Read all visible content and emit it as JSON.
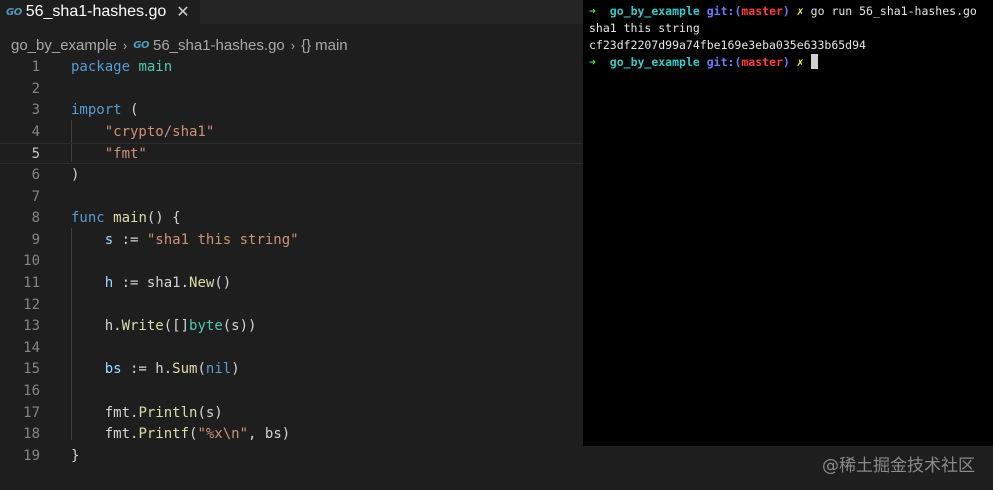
{
  "tab": {
    "icon": "go-file-icon",
    "icon_text": "GO",
    "title": "56_sha1-hashes.go",
    "close": "✕"
  },
  "breadcrumb": {
    "folder": "go_by_example",
    "sep": "›",
    "file_icon_text": "GO",
    "file": "56_sha1-hashes.go",
    "symbol_icon": "{}",
    "symbol": "main"
  },
  "editor": {
    "current_line": 5,
    "lines": [
      {
        "n": "1",
        "tokens": [
          {
            "t": "package",
            "c": "kw"
          },
          {
            "t": " main",
            "c": "ty"
          }
        ]
      },
      {
        "n": "2",
        "tokens": []
      },
      {
        "n": "3",
        "tokens": [
          {
            "t": "import",
            "c": "kw"
          },
          {
            "t": " (",
            "c": "pl"
          }
        ]
      },
      {
        "n": "4",
        "tokens": [
          {
            "t": "    \"crypto/sha1\"",
            "c": "str"
          }
        ]
      },
      {
        "n": "5",
        "tokens": [
          {
            "t": "    \"fmt\"",
            "c": "str"
          }
        ]
      },
      {
        "n": "6",
        "tokens": [
          {
            "t": ")",
            "c": "pl"
          }
        ]
      },
      {
        "n": "7",
        "tokens": []
      },
      {
        "n": "8",
        "tokens": [
          {
            "t": "func",
            "c": "kw"
          },
          {
            "t": " ",
            "c": "pl"
          },
          {
            "t": "main",
            "c": "fn"
          },
          {
            "t": "() {",
            "c": "pl"
          }
        ]
      },
      {
        "n": "9",
        "tokens": [
          {
            "t": "    s",
            "c": "var"
          },
          {
            "t": " := ",
            "c": "pl"
          },
          {
            "t": "\"sha1 this string\"",
            "c": "str"
          }
        ]
      },
      {
        "n": "10",
        "tokens": []
      },
      {
        "n": "11",
        "tokens": [
          {
            "t": "    h",
            "c": "var"
          },
          {
            "t": " := sha1.",
            "c": "pl"
          },
          {
            "t": "New",
            "c": "fn"
          },
          {
            "t": "()",
            "c": "pl"
          }
        ]
      },
      {
        "n": "12",
        "tokens": []
      },
      {
        "n": "13",
        "tokens": [
          {
            "t": "    h.",
            "c": "pl"
          },
          {
            "t": "Write",
            "c": "fn"
          },
          {
            "t": "([]",
            "c": "pl"
          },
          {
            "t": "byte",
            "c": "ty"
          },
          {
            "t": "(s))",
            "c": "pl"
          }
        ]
      },
      {
        "n": "14",
        "tokens": []
      },
      {
        "n": "15",
        "tokens": [
          {
            "t": "    bs",
            "c": "var"
          },
          {
            "t": " := h.",
            "c": "pl"
          },
          {
            "t": "Sum",
            "c": "fn"
          },
          {
            "t": "(",
            "c": "pl"
          },
          {
            "t": "nil",
            "c": "kw"
          },
          {
            "t": ")",
            "c": "pl"
          }
        ]
      },
      {
        "n": "16",
        "tokens": []
      },
      {
        "n": "17",
        "tokens": [
          {
            "t": "    fmt.",
            "c": "pl"
          },
          {
            "t": "Println",
            "c": "fn"
          },
          {
            "t": "(s)",
            "c": "pl"
          }
        ]
      },
      {
        "n": "18",
        "tokens": [
          {
            "t": "    fmt.",
            "c": "pl"
          },
          {
            "t": "Printf",
            "c": "fn"
          },
          {
            "t": "(",
            "c": "pl"
          },
          {
            "t": "\"%x\\n\"",
            "c": "str"
          },
          {
            "t": ", bs)",
            "c": "pl"
          }
        ]
      },
      {
        "n": "19",
        "tokens": [
          {
            "t": "}",
            "c": "pl"
          }
        ]
      }
    ]
  },
  "terminal": {
    "prompt_arrow": "➜",
    "dir": "go_by_example",
    "git_label": "git:(",
    "branch": "master",
    "git_close": ")",
    "dirty": "✗",
    "command": "go run 56_sha1-hashes.go",
    "output": [
      "sha1 this string",
      "cf23df2207d99a74fbe169e3eba035e633b65d94"
    ]
  },
  "watermark": "@稀土掘金技术社区"
}
